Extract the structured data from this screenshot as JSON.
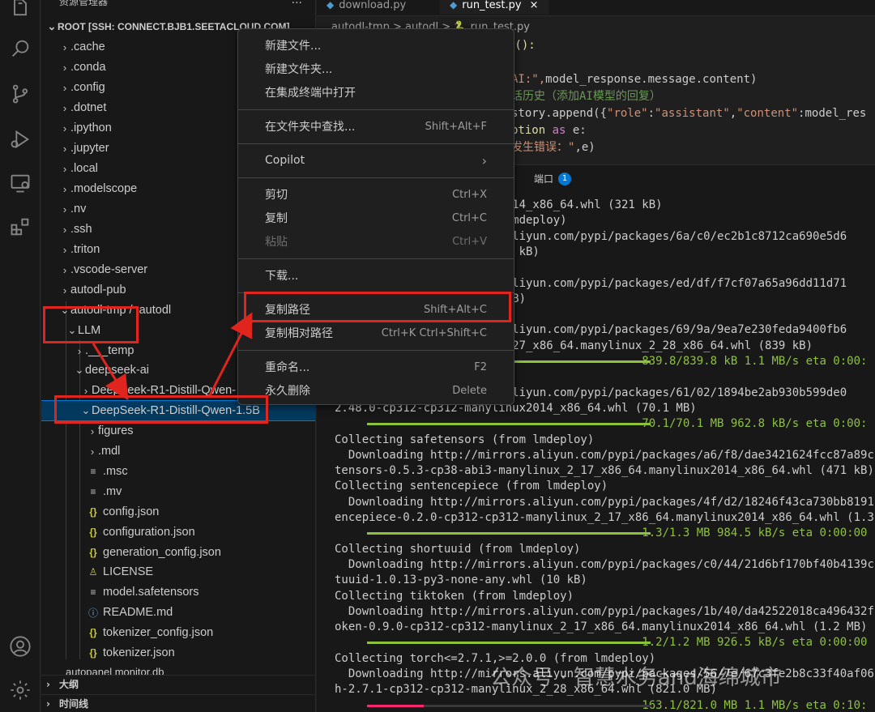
{
  "activity_bar": {
    "icons": [
      "explorer-icon",
      "search-icon",
      "source-control-icon",
      "run-debug-icon",
      "remote-explorer-icon",
      "extensions-icon",
      "account-icon",
      "settings-gear-icon"
    ]
  },
  "sidebar": {
    "title": "资源管理器",
    "more": "...",
    "root_label": "ROOT [SSH: CONNECT.BJB1.SEETACLOUD.COM]",
    "items": [
      {
        "label": ".cache"
      },
      {
        "label": ".conda"
      },
      {
        "label": ".config"
      },
      {
        "label": ".dotnet"
      },
      {
        "label": ".ipython"
      },
      {
        "label": ".jupyter"
      },
      {
        "label": ".local"
      },
      {
        "label": ".modelscope"
      },
      {
        "label": ".nv"
      },
      {
        "label": ".ssh"
      },
      {
        "label": ".triton"
      },
      {
        "label": ".vscode-server"
      },
      {
        "label": "autodl-pub"
      },
      {
        "label": "autodl-tmp / .autodl"
      },
      {
        "label": "LLM"
      },
      {
        "label": ".___temp"
      },
      {
        "label": "deepseek-ai"
      },
      {
        "label": "DeepSeek-R1-Distill-Qwen-"
      },
      {
        "label": "DeepSeek-R1-Distill-Qwen-1.5B"
      },
      {
        "label": "figures"
      },
      {
        "label": ".mdl"
      },
      {
        "label": ".msc"
      },
      {
        "label": ".mv"
      },
      {
        "label": "config.json"
      },
      {
        "label": "configuration.json"
      },
      {
        "label": "generation_config.json"
      },
      {
        "label": "LICENSE"
      },
      {
        "label": "model.safetensors"
      },
      {
        "label": "README.md"
      },
      {
        "label": "tokenizer_config.json"
      },
      {
        "label": "tokenizer.json"
      },
      {
        "label": "autopanel monitor.db"
      }
    ],
    "outline_label": "大纲",
    "timeline_label": "时间线"
  },
  "tabs": [
    {
      "label": "download.py"
    },
    {
      "label": "run_test.py",
      "close": "×"
    }
  ],
  "breadcrumb": "autodl-tmp > autodl > 🐍 run_test.py",
  "code": {
    "line1": "n():",
    "line2a": "AI:\",",
    "line2b": "model_response.message.content)",
    "line3": "话历史（添加AI模型的回复）",
    "line4a": "story.append({",
    "line4b": "\"role\"",
    "line4c": ":",
    "line4d": "\"assistant\"",
    "line4e": ",",
    "line4f": "\"content\"",
    "line4g": ":model_res",
    "line5a": "ption ",
    "line5b": "as",
    "line5c": " e:",
    "line6a": "发生错误：\"",
    "line6b": ",e)"
  },
  "panel": {
    "ports_label": "端口",
    "ports_count": "1"
  },
  "terminal": [
    "                   linux2014_x86_64.whl (321 kB)",
    "                   (from lmdeploy)",
    "                   rrors.aliyun.com/pypi/packages/6a/c0/ec2b1c8712ca690e5d6",
    "                   hl (444 kB)",
    "                   deploy)",
    "                   rrors.aliyun.com/pypi/packages/ed/df/f7cf07a65a96dd11d71",
    "                   l (26 kB)",
    "                   eploy)",
    "                   rrors.aliyun.com/pypi/packages/69/9a/9ea7e230feda9400fb6",
    "                   inux_2_27_x86_64.manylinux_2_28_x86_64.whl (839 kB)",
    "                                             839.8/839.8 kB 1.1 MB/s eta 0:00:",
    "                   loy)",
    "                   rrors.aliyun.com/pypi/packages/61/02/1894be2ab930b599de0",
    "2.48.0-cp312-cp312-manylinux2014_x86_64.whl (70.1 MB)",
    "                                             70.1/70.1 MB 962.8 kB/s eta 0:00:",
    "Collecting safetensors (from lmdeploy)",
    "  Downloading http://mirrors.aliyun.com/pypi/packages/a6/f8/dae3421624fcc87a89c",
    "tensors-0.5.3-cp38-abi3-manylinux_2_17_x86_64.manylinux2014_x86_64.whl (471 kB)",
    "Collecting sentencepiece (from lmdeploy)",
    "  Downloading http://mirrors.aliyun.com/pypi/packages/4f/d2/18246f43ca730bb8191",
    "encepiece-0.2.0-cp312-cp312-manylinux_2_17_x86_64.manylinux2014_x86_64.whl (1.3",
    "                                             1.3/1.3 MB 984.5 kB/s eta 0:00:00",
    "Collecting shortuuid (from lmdeploy)",
    "  Downloading http://mirrors.aliyun.com/pypi/packages/c0/44/21d6bf170bf40b4139c",
    "tuuid-1.0.13-py3-none-any.whl (10 kB)",
    "Collecting tiktoken (from lmdeploy)",
    "  Downloading http://mirrors.aliyun.com/pypi/packages/1b/40/da42522018ca496432f",
    "oken-0.9.0-cp312-cp312-manylinux_2_17_x86_64.manylinux2014_x86_64.whl (1.2 MB)",
    "                                             1.2/1.2 MB 926.5 kB/s eta 0:00:00",
    "Collecting torch<=2.7.1,>=2.0.0 (from lmdeploy)",
    "  Downloading http://mirrors.aliyun.com/pypi/packages/56/7e/67c3fe2b8c33f40af06",
    "h-2.7.1-cp312-cp312-manylinux_2_28_x86_64.whl (821.0 MB)",
    "                                             163.1/821.0 MB 1.1 MB/s eta 0:10:"
  ],
  "progress": [
    1.0,
    1.0,
    1.0,
    1.0,
    0.199
  ],
  "context_menu": {
    "items": [
      {
        "label": "新建文件...",
        "shortcut": ""
      },
      {
        "label": "新建文件夹...",
        "shortcut": ""
      },
      {
        "label": "在集成终端中打开",
        "shortcut": ""
      },
      {
        "label": "在文件夹中查找...",
        "shortcut": "Shift+Alt+F"
      },
      {
        "label": "Copilot",
        "shortcut": "›"
      },
      {
        "label": "剪切",
        "shortcut": "Ctrl+X"
      },
      {
        "label": "复制",
        "shortcut": "Ctrl+C"
      },
      {
        "label": "粘贴",
        "shortcut": "Ctrl+V"
      },
      {
        "label": "下载...",
        "shortcut": ""
      },
      {
        "label": "复制路径",
        "shortcut": "Shift+Alt+C"
      },
      {
        "label": "复制相对路径",
        "shortcut": "Ctrl+K Ctrl+Shift+C"
      },
      {
        "label": "重命名...",
        "shortcut": "F2"
      },
      {
        "label": "永久删除",
        "shortcut": "Delete"
      }
    ]
  },
  "watermark": "公众号 · 智慧水务and海绵城市",
  "colors": {
    "annotation_red": "#e0241e",
    "accent_blue": "#0078d4",
    "progress_green": "#8ec23b",
    "progress_pink": "#f92672"
  }
}
